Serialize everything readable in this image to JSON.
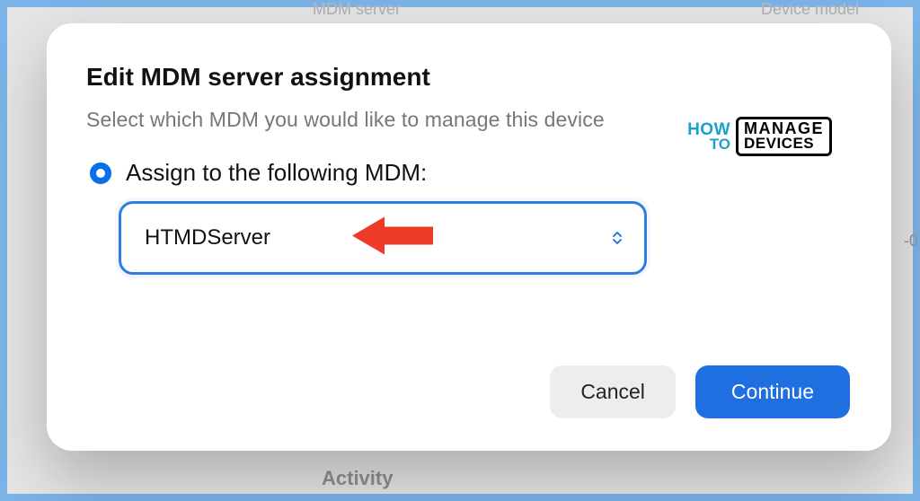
{
  "background": {
    "columns": {
      "server": "MDM server",
      "model": "Device model"
    },
    "activity_label": "Activity",
    "right_fragment": "-0"
  },
  "modal": {
    "title": "Edit MDM server assignment",
    "subtitle": "Select which MDM you would like to manage this device",
    "radio_label": "Assign to the following MDM:",
    "selected_server": "HTMDServer",
    "buttons": {
      "cancel": "Cancel",
      "continue": "Continue"
    }
  },
  "watermark": {
    "how": "HOW",
    "to": "TO",
    "manage": "MANAGE",
    "devices": "DEVICES"
  }
}
